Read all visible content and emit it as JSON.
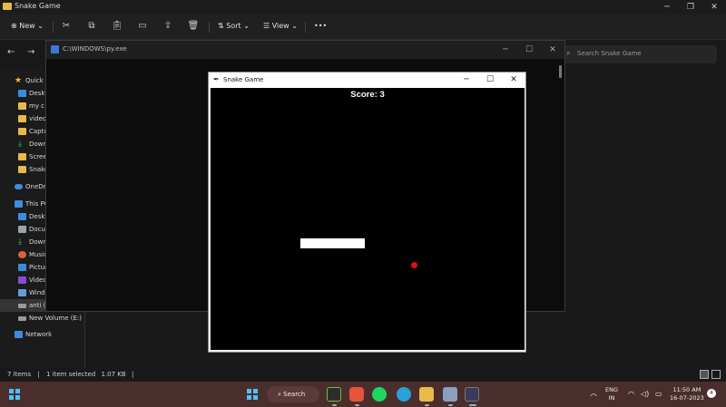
{
  "explorer": {
    "title": "Snake Game",
    "toolbar": {
      "new_label": "New",
      "sort_label": "Sort",
      "view_label": "View",
      "more_label": "•••"
    },
    "search_placeholder": "Search Snake Game",
    "sidebar": {
      "quick_access": "Quick a",
      "items": [
        "Deskt",
        "my c",
        "video",
        "Captu",
        "Down",
        "Scree",
        "Snake"
      ],
      "onedrive": "OneDri",
      "this_pc": "This PC",
      "pc_items": [
        "Deskt",
        "Docu",
        "Down",
        "Music",
        "Pictur",
        "Video",
        "Windo",
        "anti (I",
        "New Volume (E:)"
      ],
      "network": "Network"
    },
    "status": {
      "items": "7 items",
      "selected": "1 item selected",
      "size": "1.07 KB"
    }
  },
  "console": {
    "title": "C:\\WINDOWS\\py.exe"
  },
  "snake_window": {
    "title": "Snake Game",
    "score_text": "Score: 3",
    "colors": {
      "snake": "#ffffff",
      "food": "#e01010",
      "background": "#000000"
    }
  },
  "taskbar": {
    "search_label": "Search",
    "language": "ENG",
    "region": "IN",
    "time": "11:50 AM",
    "date": "16-07-2023",
    "notification_count": "4"
  }
}
